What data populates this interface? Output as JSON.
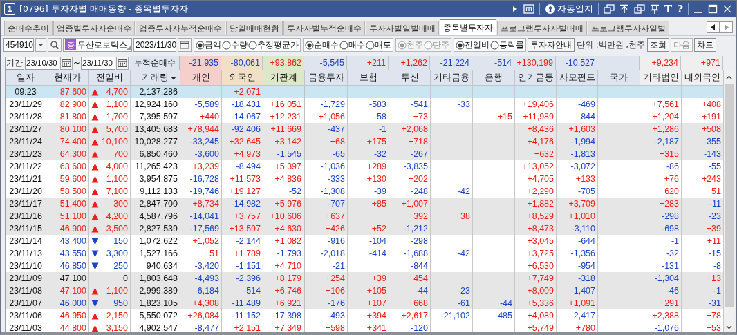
{
  "window": {
    "number": "1",
    "title": "[0796] 투자자별 매매동향 - 종목별투자자",
    "auto_log": "자동일지",
    "tool_glyphs": [
      "T",
      "?"
    ]
  },
  "tabs": [
    {
      "label": "순매수추이",
      "selected": false
    },
    {
      "label": "업종별투자자순매수",
      "selected": false
    },
    {
      "label": "업종투자자누적순매수",
      "selected": false
    },
    {
      "label": "당일매매현황",
      "selected": false
    },
    {
      "label": "투자자별누적순매수",
      "selected": false
    },
    {
      "label": "투자자별일별매매",
      "selected": false
    },
    {
      "label": "종목별투자자",
      "selected": true
    },
    {
      "label": "프로그램투자자별매매",
      "selected": false
    },
    {
      "label": "프로그램투자자일별",
      "selected": false
    }
  ],
  "controls": {
    "code": "454910",
    "market_badge": "증",
    "stock_name": "두산로보틱스",
    "date": "2023/11/30",
    "radio_groups": [
      {
        "disabled": false,
        "options": [
          {
            "label": "금액",
            "selected": true
          },
          {
            "label": "수량",
            "selected": false
          },
          {
            "label": "추정평균가",
            "selected": false
          }
        ]
      },
      {
        "disabled": false,
        "options": [
          {
            "label": "순매수",
            "selected": true
          },
          {
            "label": "매수",
            "selected": false
          },
          {
            "label": "매도",
            "selected": false
          }
        ]
      },
      {
        "disabled": true,
        "options": [
          {
            "label": "천주",
            "selected": true
          },
          {
            "label": "단주",
            "selected": false
          }
        ]
      },
      {
        "disabled": false,
        "options": [
          {
            "label": "전일비",
            "selected": true
          },
          {
            "label": "등락률",
            "selected": false
          }
        ]
      }
    ],
    "guide_button": "투자자안내",
    "unit": "단위 :백만원 ,천주",
    "buttons": [
      {
        "label": "조회",
        "disabled": false
      },
      {
        "label": "다음",
        "disabled": true
      },
      {
        "label": "차트",
        "disabled": false
      }
    ]
  },
  "period": {
    "label": "기간",
    "from": "23/10/30",
    "separator": "~",
    "to": "23/11/30",
    "summary_label": "누적순매수",
    "summary": {
      "ind": "-21,935",
      "frn": "-80,061",
      "inst": "+93,862",
      "fin": "-5,545",
      "ins": "+211",
      "trust": "+1,262",
      "ofin": "-21,224",
      "bank": "-514",
      "pens": "+130,199",
      "pef": "-10,527",
      "ocorp": "+9,234",
      "dfor": "+971"
    }
  },
  "table": {
    "columns": [
      {
        "label": "일자",
        "kind": "base",
        "dropdown": false
      },
      {
        "label": "현재가",
        "kind": "base",
        "dropdown": false
      },
      {
        "label": "전일비",
        "kind": "base",
        "dropdown": false
      },
      {
        "label": "거래량",
        "kind": "base",
        "dropdown": true
      },
      {
        "label": "개인",
        "kind": "individual",
        "dropdown": false
      },
      {
        "label": "외국인",
        "kind": "foreign",
        "dropdown": false
      },
      {
        "label": "기관계",
        "kind": "institution",
        "dropdown": false
      },
      {
        "label": "금융투자",
        "kind": "base",
        "dropdown": false
      },
      {
        "label": "보험",
        "kind": "base",
        "dropdown": false
      },
      {
        "label": "투신",
        "kind": "base",
        "dropdown": false
      },
      {
        "label": "기타금융",
        "kind": "base",
        "dropdown": false
      },
      {
        "label": "은행",
        "kind": "base",
        "dropdown": false
      },
      {
        "label": "연기금등",
        "kind": "base",
        "dropdown": false
      },
      {
        "label": "사모펀드",
        "kind": "base",
        "dropdown": false
      },
      {
        "label": "국가",
        "kind": "base",
        "dropdown": false
      },
      {
        "label": "기타법인",
        "kind": "other",
        "dropdown": false
      },
      {
        "label": "내외국인",
        "kind": "other",
        "dropdown": false
      }
    ],
    "rows": [
      {
        "date": "09:23",
        "price": "87,600",
        "rising": true,
        "falling": false,
        "change": "4,700",
        "volume": "2,137,286",
        "current": true,
        "shaded": false,
        "values": {
          "frn": "+2,071"
        }
      },
      {
        "date": "23/11/29",
        "price": "82,900",
        "rising": true,
        "falling": false,
        "change": "1,100",
        "volume": "12,924,160",
        "current": false,
        "shaded": false,
        "values": {
          "ind": "-5,589",
          "frn": "-18,431",
          "inst": "+16,051",
          "fin": "-1,729",
          "ins": "-583",
          "trust": "-541",
          "ofin": "-33",
          "pens": "+19,406",
          "pef": "-469",
          "ocorp": "+7,561",
          "dfor": "+408"
        }
      },
      {
        "date": "23/11/28",
        "price": "81,800",
        "rising": true,
        "falling": false,
        "change": "1,700",
        "volume": "7,395,597",
        "current": false,
        "shaded": false,
        "values": {
          "ind": "+440",
          "frn": "-14,067",
          "inst": "+12,231",
          "fin": "+1,056",
          "ins": "-58",
          "trust": "+73",
          "bank": "+15",
          "pens": "+11,989",
          "pef": "-844",
          "ocorp": "+1,204",
          "dfor": "+191"
        }
      },
      {
        "date": "23/11/27",
        "price": "80,100",
        "rising": true,
        "falling": false,
        "change": "5,700",
        "volume": "13,405,683",
        "current": false,
        "shaded": true,
        "values": {
          "ind": "+78,944",
          "frn": "-92,406",
          "inst": "+11,669",
          "fin": "-437",
          "ins": "-1",
          "trust": "+2,068",
          "pens": "+8,436",
          "pef": "+1,603",
          "ocorp": "+1,286",
          "dfor": "+508"
        }
      },
      {
        "date": "23/11/24",
        "price": "74,400",
        "rising": true,
        "falling": false,
        "change": "10,100",
        "volume": "10,028,277",
        "current": false,
        "shaded": true,
        "values": {
          "ind": "-33,245",
          "frn": "+32,645",
          "inst": "+3,142",
          "fin": "+68",
          "ins": "+175",
          "trust": "+718",
          "pens": "+4,176",
          "pef": "-1,994",
          "ocorp": "-2,187",
          "dfor": "-355"
        }
      },
      {
        "date": "23/11/23",
        "price": "64,300",
        "rising": true,
        "falling": false,
        "change": "700",
        "volume": "6,850,460",
        "current": false,
        "shaded": true,
        "values": {
          "ind": "-3,600",
          "frn": "+4,973",
          "inst": "-1,545",
          "fin": "-65",
          "ins": "-32",
          "trust": "-267",
          "pens": "+632",
          "pef": "-1,813",
          "ocorp": "+315",
          "dfor": "-143"
        }
      },
      {
        "date": "23/11/22",
        "price": "63,600",
        "rising": true,
        "falling": false,
        "change": "4,000",
        "volume": "11,265,423",
        "current": false,
        "shaded": false,
        "values": {
          "ind": "+3,239",
          "frn": "-8,494",
          "inst": "+5,397",
          "fin": "-1,036",
          "ins": "+289",
          "trust": "-3,835",
          "pens": "+13,052",
          "pef": "-3,072",
          "ocorp": "-86",
          "dfor": "-55"
        }
      },
      {
        "date": "23/11/21",
        "price": "59,600",
        "rising": true,
        "falling": false,
        "change": "1,100",
        "volume": "3,954,875",
        "current": false,
        "shaded": false,
        "values": {
          "ind": "-16,728",
          "frn": "+11,573",
          "inst": "+4,836",
          "fin": "-333",
          "ins": "+130",
          "trust": "+202",
          "pens": "+4,705",
          "pef": "+133",
          "ocorp": "+76",
          "dfor": "+243"
        }
      },
      {
        "date": "23/11/20",
        "price": "58,500",
        "rising": true,
        "falling": false,
        "change": "7,100",
        "volume": "9,112,133",
        "current": false,
        "shaded": false,
        "values": {
          "ind": "-19,746",
          "frn": "+19,127",
          "inst": "-52",
          "fin": "-1,308",
          "ins": "-39",
          "trust": "-248",
          "ofin": "-42",
          "pens": "+2,290",
          "pef": "-705",
          "ocorp": "+620",
          "dfor": "+51"
        }
      },
      {
        "date": "23/11/17",
        "price": "51,400",
        "rising": true,
        "falling": false,
        "change": "300",
        "volume": "2,847,700",
        "current": false,
        "shaded": true,
        "values": {
          "ind": "+8,734",
          "frn": "-14,982",
          "inst": "+5,976",
          "fin": "-707",
          "ins": "+85",
          "trust": "+1,007",
          "pens": "+1,882",
          "pef": "+3,709",
          "ocorp": "+283",
          "dfor": "-11"
        }
      },
      {
        "date": "23/11/16",
        "price": "51,100",
        "rising": true,
        "falling": false,
        "change": "4,200",
        "volume": "4,587,796",
        "current": false,
        "shaded": true,
        "values": {
          "ind": "-14,041",
          "frn": "+3,757",
          "inst": "+10,606",
          "fin": "+637",
          "trust": "+392",
          "ofin": "+38",
          "pens": "+8,529",
          "pef": "+1,010",
          "ocorp": "-298",
          "dfor": "-23"
        }
      },
      {
        "date": "23/11/15",
        "price": "46,900",
        "rising": true,
        "falling": false,
        "change": "3,500",
        "volume": "2,827,539",
        "current": false,
        "shaded": true,
        "values": {
          "ind": "-17,569",
          "frn": "+13,597",
          "inst": "+4,630",
          "fin": "+426",
          "ins": "+52",
          "trust": "-1,212",
          "pens": "+8,473",
          "pef": "-3,110",
          "ocorp": "-698",
          "dfor": "+39"
        }
      },
      {
        "date": "23/11/14",
        "price": "43,400",
        "rising": false,
        "falling": true,
        "change": "150",
        "volume": "1,072,622",
        "current": false,
        "shaded": false,
        "values": {
          "ind": "+1,052",
          "frn": "-2,144",
          "inst": "+1,082",
          "fin": "-916",
          "ins": "-104",
          "trust": "-298",
          "pens": "+3,045",
          "pef": "-644",
          "ocorp": "-1",
          "dfor": "+11"
        }
      },
      {
        "date": "23/11/13",
        "price": "43,550",
        "rising": false,
        "falling": true,
        "change": "3,300",
        "volume": "1,527,166",
        "current": false,
        "shaded": false,
        "values": {
          "ind": "+51",
          "frn": "+1,789",
          "inst": "-1,793",
          "fin": "-2,018",
          "ins": "-414",
          "trust": "-1,688",
          "ofin": "-42",
          "pens": "+3,725",
          "pef": "-1,356",
          "ocorp": "-32",
          "dfor": "-15"
        }
      },
      {
        "date": "23/11/10",
        "price": "46,850",
        "rising": false,
        "falling": true,
        "change": "250",
        "volume": "940,634",
        "current": false,
        "shaded": false,
        "values": {
          "ind": "-3,420",
          "frn": "-1,151",
          "inst": "+4,710",
          "fin": "-21",
          "trust": "-844",
          "pens": "+6,530",
          "pef": "-954",
          "ocorp": "-131",
          "dfor": "-8"
        }
      },
      {
        "date": "23/11/09",
        "price": "47,100",
        "rising": false,
        "falling": false,
        "change": "0",
        "volume": "1,803,648",
        "current": false,
        "shaded": true,
        "values": {
          "ind": "-4,493",
          "frn": "-2,396",
          "inst": "+8,179",
          "fin": "+254",
          "ins": "+39",
          "trust": "+454",
          "pens": "+7,749",
          "pef": "-318",
          "ocorp": "-1,304",
          "dfor": "+13"
        }
      },
      {
        "date": "23/11/08",
        "price": "47,100",
        "rising": true,
        "falling": false,
        "change": "1,100",
        "volume": "2,999,389",
        "current": false,
        "shaded": true,
        "values": {
          "ind": "-6,184",
          "frn": "-514",
          "inst": "+6,746",
          "fin": "+106",
          "ins": "+105",
          "trust": "-44",
          "ofin": "-23",
          "pens": "+8,009",
          "pef": "-1,407",
          "ocorp": "-46",
          "dfor": "-1"
        }
      },
      {
        "date": "23/11/07",
        "price": "46,000",
        "rising": false,
        "falling": true,
        "change": "950",
        "volume": "1,823,105",
        "current": false,
        "shaded": true,
        "values": {
          "ind": "+4,308",
          "frn": "-11,489",
          "inst": "+6,921",
          "fin": "-176",
          "ins": "+107",
          "trust": "+668",
          "ofin": "-61",
          "bank": "-44",
          "pens": "+5,336",
          "pef": "+1,091",
          "ocorp": "+291",
          "dfor": "-31"
        }
      },
      {
        "date": "23/11/06",
        "price": "46,950",
        "rising": true,
        "falling": false,
        "change": "2,150",
        "volume": "5,550,072",
        "current": false,
        "shaded": false,
        "values": {
          "ind": "+26,084",
          "frn": "-11,152",
          "inst": "-17,398",
          "fin": "-493",
          "ins": "+394",
          "trust": "+2,617",
          "ofin": "-21,102",
          "bank": "-485",
          "pens": "+4,089",
          "pef": "-2,417",
          "ocorp": "+2,388",
          "dfor": "+78"
        }
      },
      {
        "date": "23/11/03",
        "price": "44,800",
        "rising": true,
        "falling": false,
        "change": "3,150",
        "volume": "4,902,547",
        "current": false,
        "shaded": false,
        "values": {
          "ind": "-8,477",
          "frn": "+2,151",
          "inst": "+7,349",
          "fin": "+598",
          "ins": "+341",
          "trust": "-120",
          "pens": "+5,749",
          "pef": "+780",
          "ocorp": "-1,076",
          "dfor": "+53"
        }
      }
    ]
  }
}
